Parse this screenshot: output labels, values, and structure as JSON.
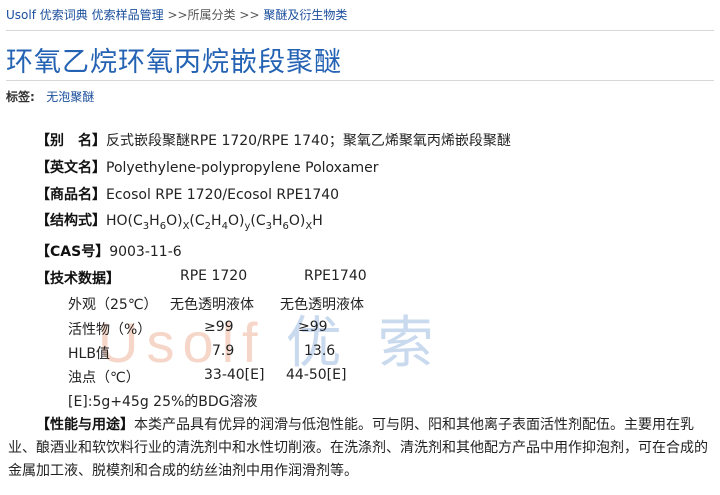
{
  "breadcrumb": {
    "items": [
      "Usolf 优索词典",
      "优索样品管理",
      "所属分类",
      "聚醚及衍生物类"
    ],
    "separator": ">>"
  },
  "title": "环氧乙烷环氧丙烷嵌段聚醚",
  "tags": {
    "label": "标签:",
    "value": "无泡聚醚"
  },
  "fields": {
    "alias": {
      "label": "【别　名】",
      "value": "反式嵌段聚醚RPE 1720/RPE 1740；聚氧乙烯聚氧丙烯嵌段聚醚"
    },
    "english": {
      "label": "【英文名】",
      "value": "Polyethylene-polypropylene Poloxamer"
    },
    "trade": {
      "label": "【商品名】",
      "value": "Ecosol RPE 1720/Ecosol RPE1740"
    },
    "formula": {
      "label": "【结构式】",
      "p1": "HO(C",
      "s1": "3",
      "p2": "H",
      "s2": "6",
      "p3": "O)",
      "s3": "X",
      "p4": "(C",
      "s4": "2",
      "p5": "H",
      "s5": "4",
      "p6": "O)",
      "s6": "y",
      "p7": "(C",
      "s7": "3",
      "p8": "H",
      "s8": "6",
      "p9": "O)",
      "s9": "X",
      "p10": "H"
    },
    "cas": {
      "label": "【CAS号】",
      "value": "9003-11-6"
    }
  },
  "tech": {
    "label": "【技术数据】",
    "col1": "RPE 1720",
    "col2": "RPE1740",
    "rows": [
      {
        "name": "外观（25℃）",
        "v1": "无色透明液体",
        "v2": "无色透明液体"
      },
      {
        "name": "活性物（%）",
        "v1": "≥99",
        "v2": "≥99"
      },
      {
        "name": "HLB值",
        "v1": "7.9",
        "v2": "13.6"
      },
      {
        "name": "浊点（℃）",
        "v1": "33-40[E]",
        "v2": "44-50[E]"
      }
    ],
    "note": "[E]:5g+45g 25%的BDG溶液"
  },
  "usage": {
    "label": "【性能与用途】",
    "text": "本类产品具有优异的润滑与低泡性能。可与阴、阳和其他离子表面活性剂配伍。主要用在乳业、酿酒业和软饮料行业的清洗剂中和水性切削液。在洗涤剂、清洗剂和其他配方产品中用作抑泡剂，可在合成的金属加工液、脱模剂和合成的纺丝油剂中用作润滑剂等。"
  },
  "watermark": {
    "en": "Usolf",
    "cn": "优索"
  }
}
